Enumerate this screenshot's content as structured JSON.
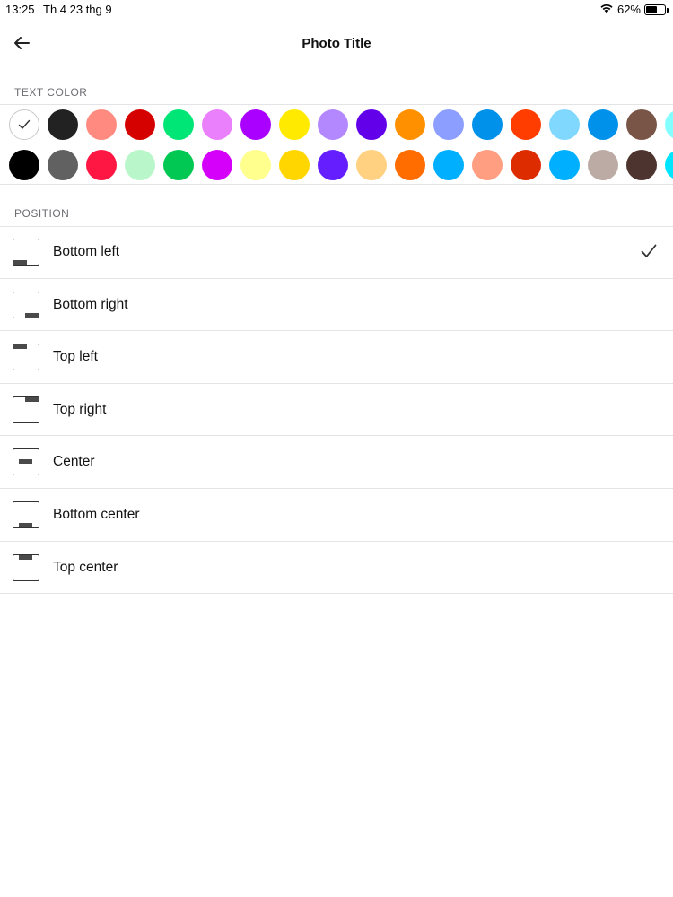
{
  "status_bar": {
    "time": "13:25",
    "date": "Th 4 23 thg 9",
    "battery_text": "62%",
    "battery_level": 0.62,
    "icons": [
      "wifi-icon",
      "battery-icon"
    ]
  },
  "nav": {
    "title": "Photo Title",
    "back_icon": "arrow-left-icon"
  },
  "text_color": {
    "header": "TEXT COLOR",
    "selected": "#ffffff",
    "row1": [
      "#ffffff",
      "#222222",
      "#ff8a80",
      "#d50000",
      "#00e676",
      "#ea80fc",
      "#aa00ff",
      "#ffea00",
      "#b388ff",
      "#6200ea",
      "#ff9100",
      "#8c9eff",
      "#0091ea",
      "#ff3d00",
      "#80d8ff",
      "#0091ea",
      "#795548",
      "#84ffff"
    ],
    "row2": [
      "#000000",
      "#616161",
      "#ff1744",
      "#b9f6ca",
      "#00c853",
      "#d500f9",
      "#ffff8d",
      "#ffd600",
      "#651fff",
      "#ffd180",
      "#ff6d00",
      "#00b0ff",
      "#ff9e80",
      "#dd2c00",
      "#00b0ff",
      "#bcaaa4",
      "#4e342e",
      "#00e5ff"
    ]
  },
  "position": {
    "header": "POSITION",
    "selected": "Bottom left",
    "items": [
      {
        "label": "Bottom left",
        "icon": "position-bottom-left-icon",
        "selected": true
      },
      {
        "label": "Bottom right",
        "icon": "position-bottom-right-icon",
        "selected": false
      },
      {
        "label": "Top left",
        "icon": "position-top-left-icon",
        "selected": false
      },
      {
        "label": "Top right",
        "icon": "position-top-right-icon",
        "selected": false
      },
      {
        "label": "Center",
        "icon": "position-center-icon",
        "selected": false
      },
      {
        "label": "Bottom center",
        "icon": "position-bottom-center-icon",
        "selected": false
      },
      {
        "label": "Top center",
        "icon": "position-top-center-icon",
        "selected": false
      }
    ]
  }
}
